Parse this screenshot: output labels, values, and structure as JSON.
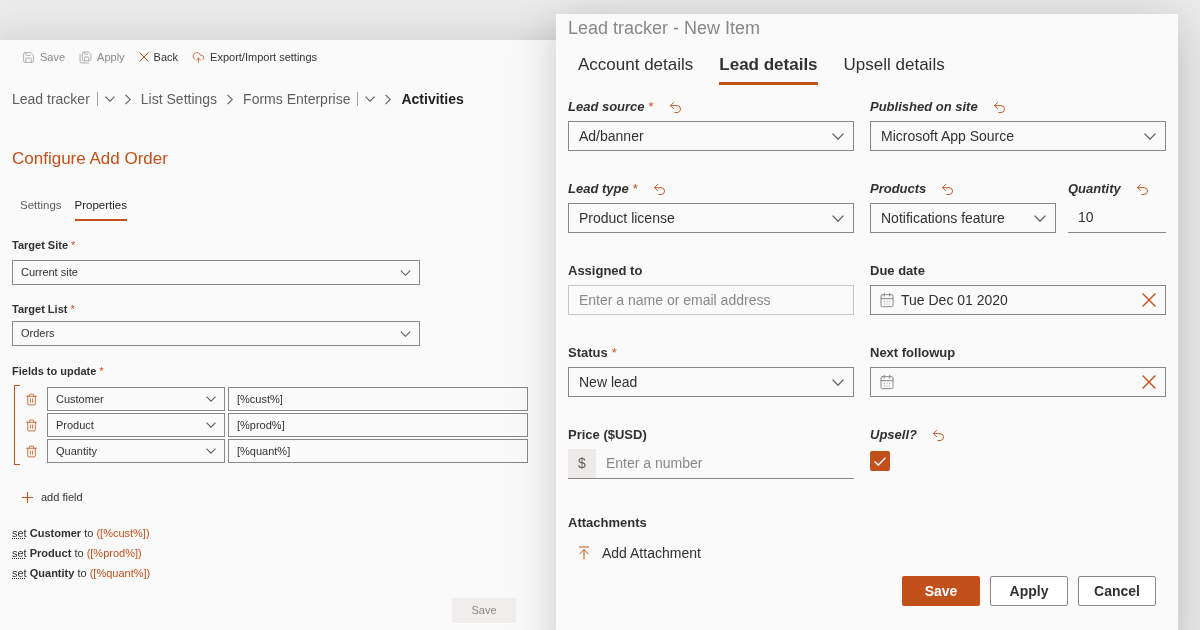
{
  "config_panel": {
    "toolbar": [
      {
        "kind": "save",
        "label": "Save",
        "disabled": true
      },
      {
        "kind": "apply",
        "label": "Apply",
        "disabled": true
      },
      {
        "kind": "back",
        "label": "Back",
        "disabled": false
      },
      {
        "kind": "export",
        "label": "Export/Import settings",
        "disabled": false
      }
    ],
    "breadcrumb": [
      {
        "label": "Lead tracker",
        "has_menu": true,
        "current": false
      },
      {
        "label": "List Settings",
        "has_menu": false,
        "current": false
      },
      {
        "label": "Forms Enterprise",
        "has_menu": true,
        "current": false
      },
      {
        "label": "Activities",
        "has_menu": false,
        "current": true
      }
    ],
    "title": "Configure Add Order",
    "tabs": [
      {
        "label": "Settings",
        "selected": false
      },
      {
        "label": "Properties",
        "selected": true
      }
    ],
    "target_site": {
      "label": "Target Site",
      "required_mark": "*",
      "value": "Current site"
    },
    "target_list": {
      "label": "Target List",
      "required_mark": "*",
      "value": "Orders"
    },
    "fields_to_update": {
      "label": "Fields to update",
      "required_mark": "*",
      "rows": [
        {
          "field": "Customer",
          "value": "[%cust%]"
        },
        {
          "field": "Product",
          "value": "[%prod%]"
        },
        {
          "field": "Quantity",
          "value": "[%quant%]"
        }
      ]
    },
    "add_field": "add field",
    "summary": [
      {
        "verb": "set",
        "field": "Customer",
        "connector": "to",
        "value": "([%cust%])"
      },
      {
        "verb": "set",
        "field": "Product",
        "connector": "to",
        "value": "([%prod%])"
      },
      {
        "verb": "set",
        "field": "Quantity",
        "connector": "to",
        "value": "([%quant%])"
      }
    ],
    "save_button": {
      "label": "Save",
      "disabled": true
    }
  },
  "item_form": {
    "title": "Lead tracker - New Item",
    "tabs": [
      {
        "label": "Account details",
        "selected": false
      },
      {
        "label": "Lead details",
        "selected": true
      },
      {
        "label": "Upsell details",
        "selected": false
      }
    ],
    "rows": [
      {
        "fields": [
          {
            "kind": "dropdown",
            "label": "Lead source",
            "required_mark": "*",
            "changed": true,
            "value": "Ad/banner"
          },
          {
            "kind": "dropdown",
            "label": "Published on site",
            "changed": true,
            "value": "Microsoft App Source"
          }
        ]
      },
      {
        "fields": [
          {
            "kind": "dropdown",
            "label": "Lead type",
            "required_mark": "*",
            "changed": true,
            "value": "Product license"
          },
          {
            "kind": "dropdown",
            "label": "Products",
            "changed": true,
            "value": "Notifications feature"
          },
          {
            "kind": "underlined",
            "label": "Quantity",
            "changed": true,
            "value": "10"
          }
        ]
      },
      {
        "fields": [
          {
            "kind": "people",
            "label": "Assigned to",
            "changed": false,
            "placeholder": "Enter a name or email address"
          },
          {
            "kind": "date",
            "label": "Due date",
            "changed": false,
            "value": "Tue Dec 01 2020"
          }
        ]
      },
      {
        "fields": [
          {
            "kind": "dropdown",
            "label": "Status",
            "required_mark": "*",
            "changed": false,
            "value": "New lead"
          },
          {
            "kind": "date",
            "label": "Next followup",
            "changed": false
          }
        ]
      },
      {
        "fields": [
          {
            "kind": "currency",
            "label": "Price ($USD)",
            "changed": false,
            "prefix": "$",
            "placeholder": "Enter a number"
          },
          {
            "kind": "checkbox",
            "label": "Upsell?",
            "changed": true,
            "checked": true
          }
        ]
      }
    ],
    "attachments": {
      "label": "Attachments",
      "action": "Add Attachment"
    },
    "buttons": [
      {
        "label": "Save",
        "primary": true
      },
      {
        "label": "Apply",
        "primary": false
      },
      {
        "label": "Cancel",
        "primary": false
      }
    ]
  }
}
